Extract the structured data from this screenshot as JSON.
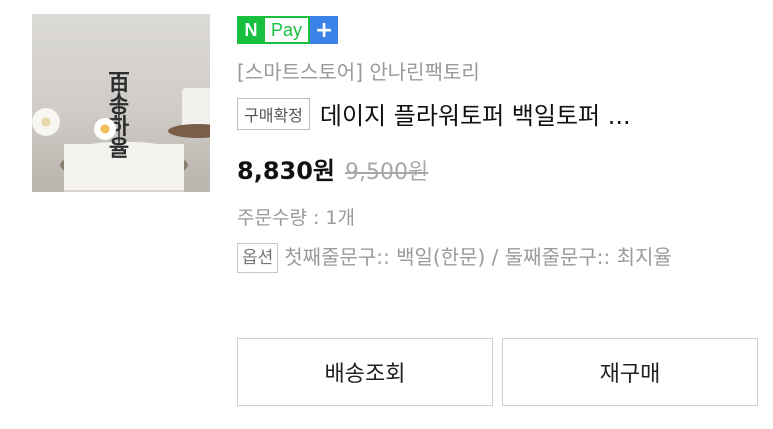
{
  "product": {
    "image_alt": "cake topper product photo",
    "topper_text": "百\n송\n하\n율"
  },
  "npay": {
    "n": "N",
    "pay": "Pay",
    "plus": "+"
  },
  "store_name": "[스마트스토어] 안나린팩토리",
  "status_badge": "구매확정",
  "title": "데이지 플라워토퍼 백일토퍼 ...",
  "price": "8,830원",
  "original_price": "9,500원",
  "quantity": "주문수량 : 1개",
  "option": {
    "badge": "옵션",
    "text": "첫째줄문구:: 백일(한문) / 둘째줄문구:: 최지율"
  },
  "buttons": {
    "track": "배송조회",
    "rebuy": "재구매"
  },
  "colors": {
    "npay_green": "#19c040",
    "plus_blue": "#3b82e8"
  }
}
